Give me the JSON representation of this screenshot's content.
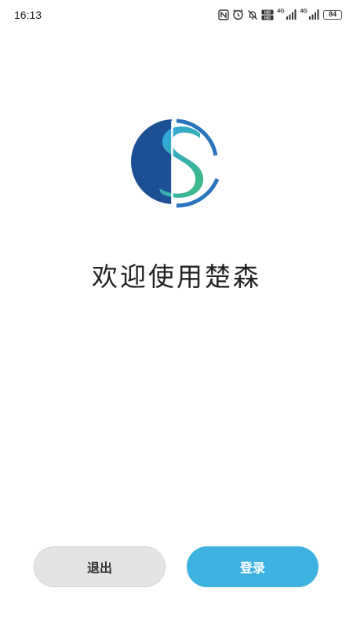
{
  "status_bar": {
    "time": "16:13",
    "icons": [
      "nfc-icon",
      "alarm-icon",
      "mute-icon",
      "hd-icon",
      "signal-icon",
      "signal-icon"
    ],
    "network_1": "4G",
    "network_2": "4G",
    "battery": "84"
  },
  "logo": {
    "letter": "S",
    "colors": {
      "dark_blue": "#1d4f95",
      "light_blue": "#3aa9e0",
      "green": "#3dbd7d"
    }
  },
  "welcome_text": "欢迎使用楚森",
  "buttons": {
    "exit_label": "退出",
    "login_label": "登录"
  },
  "colors": {
    "accent": "#3db2e0",
    "secondary_button": "#e4e4e4"
  }
}
